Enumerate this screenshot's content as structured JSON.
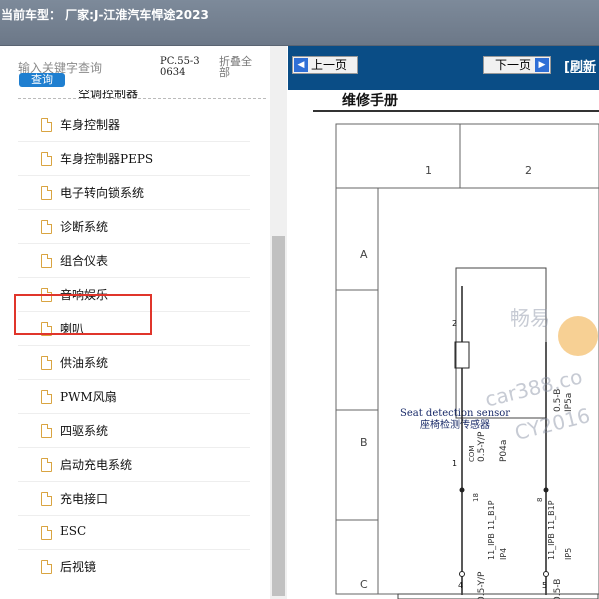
{
  "topbar": {
    "title": "当前车型： 厂家:J-江淮汽车悍途2023"
  },
  "left": {
    "search_placeholder": "输入关键字查询",
    "query_button": "查询",
    "code": "PC.55-30634",
    "fold_all": "折叠全部",
    "partial_item": "空调控制器",
    "items": [
      "车身控制器",
      "车身控制器PEPS",
      "电子转向锁系统",
      "诊断系统",
      "组合仪表",
      "音响娱乐",
      "喇叭",
      "供油系统",
      "PWM风扇",
      "四驱系统",
      "启动充电系统",
      "充电接口",
      "ESC",
      "后视镜"
    ]
  },
  "viewer": {
    "prev_button": "上一页",
    "next_button": "下一页",
    "refresh_link": "[刷新",
    "doc_title": "维修手册",
    "diagram": {
      "col_labels": [
        "1",
        "2"
      ],
      "row_labels": [
        "A",
        "B",
        "C"
      ],
      "sensor_en": "Seat detection sensor",
      "sensor_cn": "座椅检测传感器",
      "pin_top": "2",
      "pin_mid": "1",
      "left_wire_top": "0.5-Y/P",
      "left_wire_bottom": "0.5-Y/P",
      "right_wire_top": "0.5-B",
      "right_wire_bottom": "0.5-B",
      "com_label": "COM",
      "conn_left_top": "11_B1P",
      "conn_left_bottom": "11_IPB",
      "conn_right_top": "11_B1P",
      "conn_right_bottom": "11_IPB",
      "ref_left_top": "P04a",
      "ref_right_top": "IP5a",
      "ref_left_bottom": "IP4",
      "ref_right_bottom": "IP5",
      "pin_num_a": "18",
      "pin_num_b": "4",
      "pin_num_c": "5",
      "pin_num_d": "8"
    },
    "watermarks": [
      "畅易",
      "car388.co",
      "CY2016"
    ]
  }
}
